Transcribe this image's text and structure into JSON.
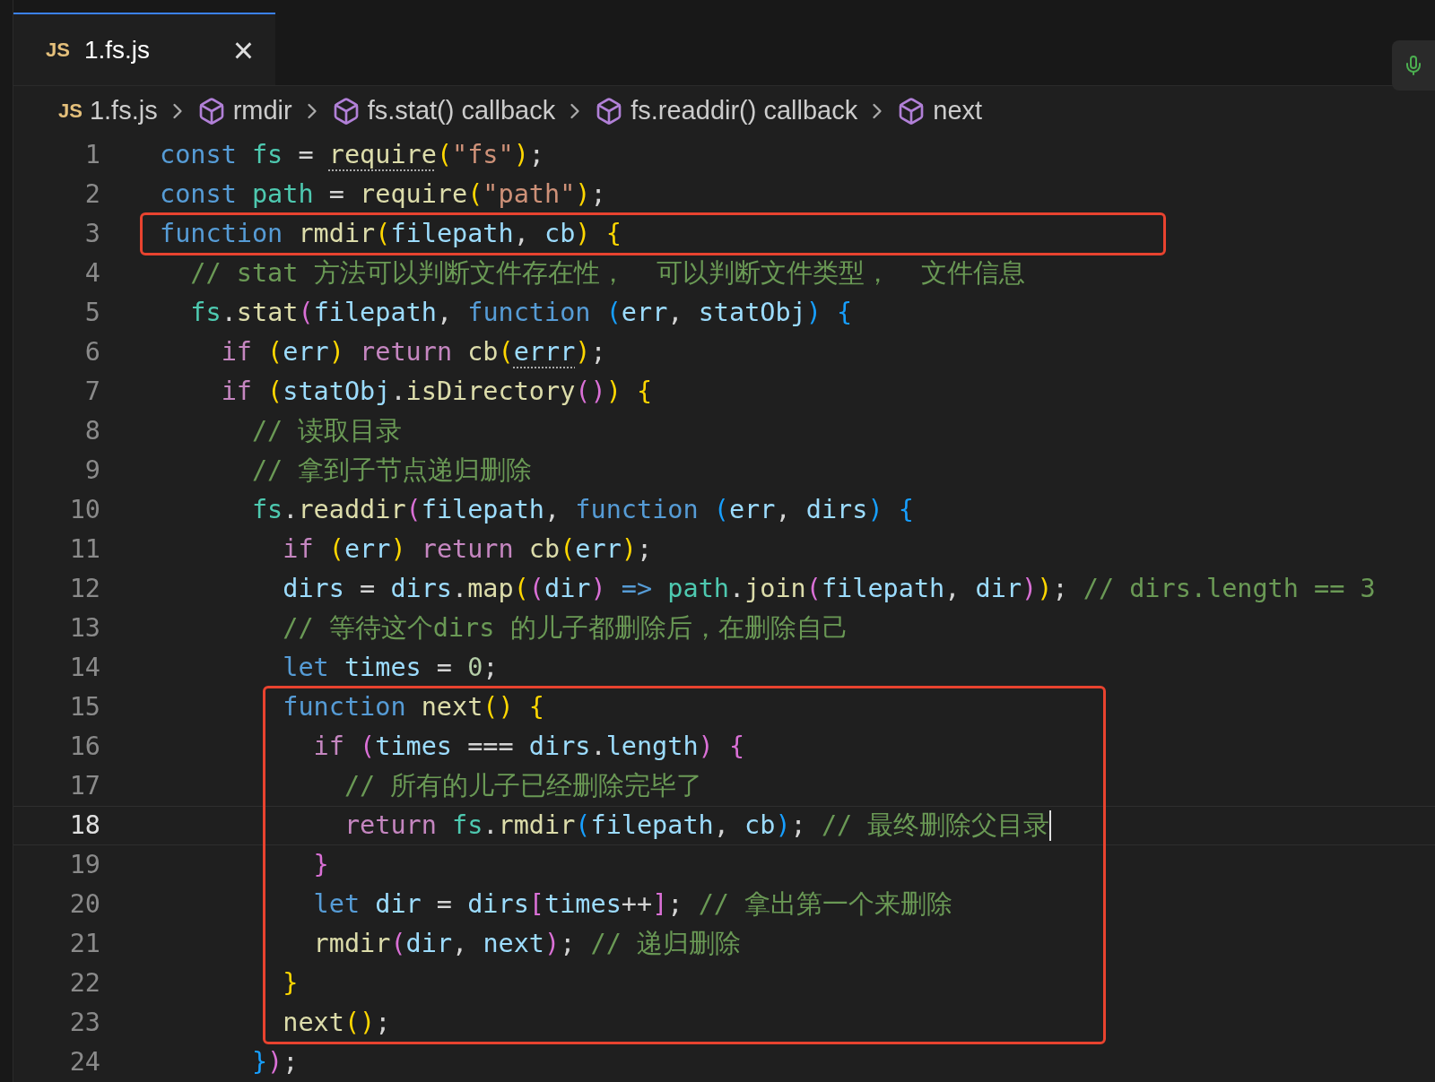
{
  "tabs": [
    {
      "badge": "JS",
      "label": "1.fs.js",
      "selected": true,
      "close": "×"
    }
  ],
  "breadcrumbs": [
    {
      "kind": "file",
      "badge": "JS",
      "label": "1.fs.js"
    },
    {
      "kind": "symbol",
      "label": "rmdir"
    },
    {
      "kind": "symbol",
      "label": "fs.stat() callback"
    },
    {
      "kind": "symbol",
      "label": "fs.readdir() callback"
    },
    {
      "kind": "symbol",
      "label": "next"
    }
  ],
  "code": [
    {
      "boxed": false,
      "lines": [
        {
          "number": "1",
          "current": false,
          "tokens": [
            {
              "t": "const ",
              "color": "#569cd6"
            },
            {
              "t": "fs",
              "color": "#4ec9b0"
            },
            {
              "t": " = ",
              "color": "#d4d4d4"
            },
            {
              "t": "require",
              "color": "#dcdcaa",
              "dotted": true
            },
            {
              "t": "(",
              "color": "#ffd700"
            },
            {
              "t": "\"fs\"",
              "color": "#ce9178"
            },
            {
              "t": ")",
              "color": "#ffd700"
            },
            {
              "t": ";",
              "color": "#d4d4d4"
            }
          ]
        },
        {
          "number": "2",
          "current": false,
          "tokens": [
            {
              "t": "const ",
              "color": "#569cd6"
            },
            {
              "t": "path",
              "color": "#4ec9b0"
            },
            {
              "t": " = ",
              "color": "#d4d4d4"
            },
            {
              "t": "require",
              "color": "#dcdcaa",
              "dotted": false
            },
            {
              "t": "(",
              "color": "#ffd700"
            },
            {
              "t": "\"path\"",
              "color": "#ce9178"
            },
            {
              "t": ")",
              "color": "#ffd700"
            },
            {
              "t": ";",
              "color": "#d4d4d4"
            }
          ]
        }
      ]
    },
    {
      "boxed": true,
      "lines": [
        {
          "number": "3",
          "current": false,
          "tokens": [
            {
              "t": "function ",
              "color": "#569cd6"
            },
            {
              "t": "rmdir",
              "color": "#dcdcaa"
            },
            {
              "t": "(",
              "color": "#ffd700"
            },
            {
              "t": "filepath",
              "color": "#9cdcfe"
            },
            {
              "t": ", ",
              "color": "#d4d4d4"
            },
            {
              "t": "cb",
              "color": "#9cdcfe"
            },
            {
              "t": ") {",
              "color": "#ffd700"
            }
          ]
        }
      ]
    },
    {
      "boxed": false,
      "lines": [
        {
          "number": "4",
          "current": false,
          "tokens": [
            {
              "t": "  // stat 方法可以判断文件存在性，  可以判断文件类型，  文件信息",
              "color": "#6a9955"
            }
          ]
        },
        {
          "number": "5",
          "current": false,
          "tokens": [
            {
              "t": "  fs",
              "color": "#4ec9b0"
            },
            {
              "t": ".",
              "color": "#d4d4d4"
            },
            {
              "t": "stat",
              "color": "#dcdcaa"
            },
            {
              "t": "(",
              "color": "#da70d6"
            },
            {
              "t": "filepath",
              "color": "#9cdcfe"
            },
            {
              "t": ", ",
              "color": "#d4d4d4"
            },
            {
              "t": "function ",
              "color": "#569cd6"
            },
            {
              "t": "(",
              "color": "#179fff"
            },
            {
              "t": "err",
              "color": "#9cdcfe"
            },
            {
              "t": ", ",
              "color": "#d4d4d4"
            },
            {
              "t": "statObj",
              "color": "#9cdcfe"
            },
            {
              "t": ") {",
              "color": "#179fff"
            }
          ]
        },
        {
          "number": "6",
          "current": false,
          "tokens": [
            {
              "t": "    if ",
              "color": "#c586c0"
            },
            {
              "t": "(",
              "color": "#ffd700"
            },
            {
              "t": "err",
              "color": "#9cdcfe"
            },
            {
              "t": ") ",
              "color": "#ffd700"
            },
            {
              "t": "return ",
              "color": "#c586c0"
            },
            {
              "t": "cb",
              "color": "#dcdcaa"
            },
            {
              "t": "(",
              "color": "#ffd700"
            },
            {
              "t": "errr",
              "color": "#9cdcfe",
              "dotted": true
            },
            {
              "t": ")",
              "color": "#ffd700"
            },
            {
              "t": ";",
              "color": "#d4d4d4"
            }
          ]
        },
        {
          "number": "7",
          "current": false,
          "tokens": [
            {
              "t": "    if ",
              "color": "#c586c0"
            },
            {
              "t": "(",
              "color": "#ffd700"
            },
            {
              "t": "statObj",
              "color": "#9cdcfe"
            },
            {
              "t": ".",
              "color": "#d4d4d4"
            },
            {
              "t": "isDirectory",
              "color": "#dcdcaa"
            },
            {
              "t": "()",
              "color": "#da70d6"
            },
            {
              "t": ") {",
              "color": "#ffd700"
            }
          ]
        },
        {
          "number": "8",
          "current": false,
          "tokens": [
            {
              "t": "      // 读取目录",
              "color": "#6a9955"
            }
          ]
        },
        {
          "number": "9",
          "current": false,
          "tokens": [
            {
              "t": "      // 拿到子节点递归删除",
              "color": "#6a9955"
            }
          ]
        },
        {
          "number": "10",
          "current": false,
          "tokens": [
            {
              "t": "      fs",
              "color": "#4ec9b0"
            },
            {
              "t": ".",
              "color": "#d4d4d4"
            },
            {
              "t": "readdir",
              "color": "#dcdcaa"
            },
            {
              "t": "(",
              "color": "#da70d6"
            },
            {
              "t": "filepath",
              "color": "#9cdcfe"
            },
            {
              "t": ", ",
              "color": "#d4d4d4"
            },
            {
              "t": "function ",
              "color": "#569cd6"
            },
            {
              "t": "(",
              "color": "#179fff"
            },
            {
              "t": "err",
              "color": "#9cdcfe"
            },
            {
              "t": ", ",
              "color": "#d4d4d4"
            },
            {
              "t": "dirs",
              "color": "#9cdcfe"
            },
            {
              "t": ") {",
              "color": "#179fff"
            }
          ]
        },
        {
          "number": "11",
          "current": false,
          "tokens": [
            {
              "t": "        if ",
              "color": "#c586c0"
            },
            {
              "t": "(",
              "color": "#ffd700"
            },
            {
              "t": "err",
              "color": "#9cdcfe"
            },
            {
              "t": ") ",
              "color": "#ffd700"
            },
            {
              "t": "return ",
              "color": "#c586c0"
            },
            {
              "t": "cb",
              "color": "#dcdcaa"
            },
            {
              "t": "(",
              "color": "#ffd700"
            },
            {
              "t": "err",
              "color": "#9cdcfe"
            },
            {
              "t": ")",
              "color": "#ffd700"
            },
            {
              "t": ";",
              "color": "#d4d4d4"
            }
          ]
        },
        {
          "number": "12",
          "current": false,
          "tokens": [
            {
              "t": "        dirs",
              "color": "#9cdcfe"
            },
            {
              "t": " = ",
              "color": "#d4d4d4"
            },
            {
              "t": "dirs",
              "color": "#9cdcfe"
            },
            {
              "t": ".",
              "color": "#d4d4d4"
            },
            {
              "t": "map",
              "color": "#dcdcaa"
            },
            {
              "t": "(",
              "color": "#ffd700"
            },
            {
              "t": "(",
              "color": "#da70d6"
            },
            {
              "t": "dir",
              "color": "#9cdcfe"
            },
            {
              "t": ") ",
              "color": "#da70d6"
            },
            {
              "t": "=> ",
              "color": "#569cd6"
            },
            {
              "t": "path",
              "color": "#4ec9b0"
            },
            {
              "t": ".",
              "color": "#d4d4d4"
            },
            {
              "t": "join",
              "color": "#dcdcaa"
            },
            {
              "t": "(",
              "color": "#da70d6"
            },
            {
              "t": "filepath",
              "color": "#9cdcfe"
            },
            {
              "t": ", ",
              "color": "#d4d4d4"
            },
            {
              "t": "dir",
              "color": "#9cdcfe"
            },
            {
              "t": ")",
              "color": "#da70d6"
            },
            {
              "t": ")",
              "color": "#ffd700"
            },
            {
              "t": "; ",
              "color": "#d4d4d4"
            },
            {
              "t": "// dirs.length == 3",
              "color": "#6a9955"
            }
          ]
        },
        {
          "number": "13",
          "current": false,
          "tokens": [
            {
              "t": "        // 等待这个dirs 的儿子都删除后，在删除自己",
              "color": "#6a9955"
            }
          ]
        },
        {
          "number": "14",
          "current": false,
          "tokens": [
            {
              "t": "        let ",
              "color": "#569cd6"
            },
            {
              "t": "times",
              "color": "#9cdcfe"
            },
            {
              "t": " = ",
              "color": "#d4d4d4"
            },
            {
              "t": "0",
              "color": "#b5cea8"
            },
            {
              "t": ";",
              "color": "#d4d4d4"
            }
          ]
        }
      ]
    },
    {
      "boxed": true,
      "lines": [
        {
          "number": "15",
          "current": false,
          "tokens": [
            {
              "t": "        function ",
              "color": "#569cd6"
            },
            {
              "t": "next",
              "color": "#dcdcaa"
            },
            {
              "t": "() {",
              "color": "#ffd700"
            }
          ]
        },
        {
          "number": "16",
          "current": false,
          "tokens": [
            {
              "t": "          if ",
              "color": "#c586c0"
            },
            {
              "t": "(",
              "color": "#da70d6"
            },
            {
              "t": "times",
              "color": "#9cdcfe"
            },
            {
              "t": " === ",
              "color": "#d4d4d4"
            },
            {
              "t": "dirs",
              "color": "#9cdcfe"
            },
            {
              "t": ".",
              "color": "#d4d4d4"
            },
            {
              "t": "length",
              "color": "#9cdcfe"
            },
            {
              "t": ") {",
              "color": "#da70d6"
            }
          ]
        },
        {
          "number": "17",
          "current": false,
          "tokens": [
            {
              "t": "            // 所有的儿子已经删除完毕了",
              "color": "#6a9955"
            }
          ]
        },
        {
          "number": "18",
          "current": true,
          "tokens": [
            {
              "t": "            return ",
              "color": "#c586c0"
            },
            {
              "t": "fs",
              "color": "#4ec9b0"
            },
            {
              "t": ".",
              "color": "#d4d4d4"
            },
            {
              "t": "rmdir",
              "color": "#dcdcaa"
            },
            {
              "t": "(",
              "color": "#179fff"
            },
            {
              "t": "filepath",
              "color": "#9cdcfe"
            },
            {
              "t": ", ",
              "color": "#d4d4d4"
            },
            {
              "t": "cb",
              "color": "#9cdcfe"
            },
            {
              "t": ")",
              "color": "#179fff"
            },
            {
              "t": "; ",
              "color": "#d4d4d4"
            },
            {
              "t": "// 最终删除父目录",
              "color": "#6a9955"
            }
          ]
        },
        {
          "number": "19",
          "current": false,
          "tokens": [
            {
              "t": "          }",
              "color": "#da70d6"
            }
          ]
        },
        {
          "number": "20",
          "current": false,
          "tokens": [
            {
              "t": "          let ",
              "color": "#569cd6"
            },
            {
              "t": "dir",
              "color": "#9cdcfe"
            },
            {
              "t": " = ",
              "color": "#d4d4d4"
            },
            {
              "t": "dirs",
              "color": "#9cdcfe"
            },
            {
              "t": "[",
              "color": "#da70d6"
            },
            {
              "t": "times",
              "color": "#9cdcfe"
            },
            {
              "t": "++",
              "color": "#d4d4d4"
            },
            {
              "t": "]",
              "color": "#da70d6"
            },
            {
              "t": "; ",
              "color": "#d4d4d4"
            },
            {
              "t": "// 拿出第一个来删除",
              "color": "#6a9955"
            }
          ]
        },
        {
          "number": "21",
          "current": false,
          "tokens": [
            {
              "t": "          rmdir",
              "color": "#dcdcaa"
            },
            {
              "t": "(",
              "color": "#da70d6"
            },
            {
              "t": "dir",
              "color": "#9cdcfe"
            },
            {
              "t": ", ",
              "color": "#d4d4d4"
            },
            {
              "t": "next",
              "color": "#9cdcfe"
            },
            {
              "t": ")",
              "color": "#da70d6"
            },
            {
              "t": "; ",
              "color": "#d4d4d4"
            },
            {
              "t": "// 递归删除",
              "color": "#6a9955"
            }
          ]
        },
        {
          "number": "22",
          "current": false,
          "tokens": [
            {
              "t": "        }",
              "color": "#ffd700"
            }
          ]
        },
        {
          "number": "23",
          "current": false,
          "tokens": [
            {
              "t": "        next",
              "color": "#dcdcaa"
            },
            {
              "t": "()",
              "color": "#ffd700"
            },
            {
              "t": ";",
              "color": "#d4d4d4"
            }
          ]
        }
      ]
    },
    {
      "boxed": false,
      "lines": [
        {
          "number": "24",
          "current": false,
          "tokens": [
            {
              "t": "      }",
              "color": "#179fff"
            },
            {
              "t": ")",
              "color": "#da70d6"
            },
            {
              "t": ";",
              "color": "#d4d4d4"
            }
          ]
        }
      ]
    }
  ]
}
